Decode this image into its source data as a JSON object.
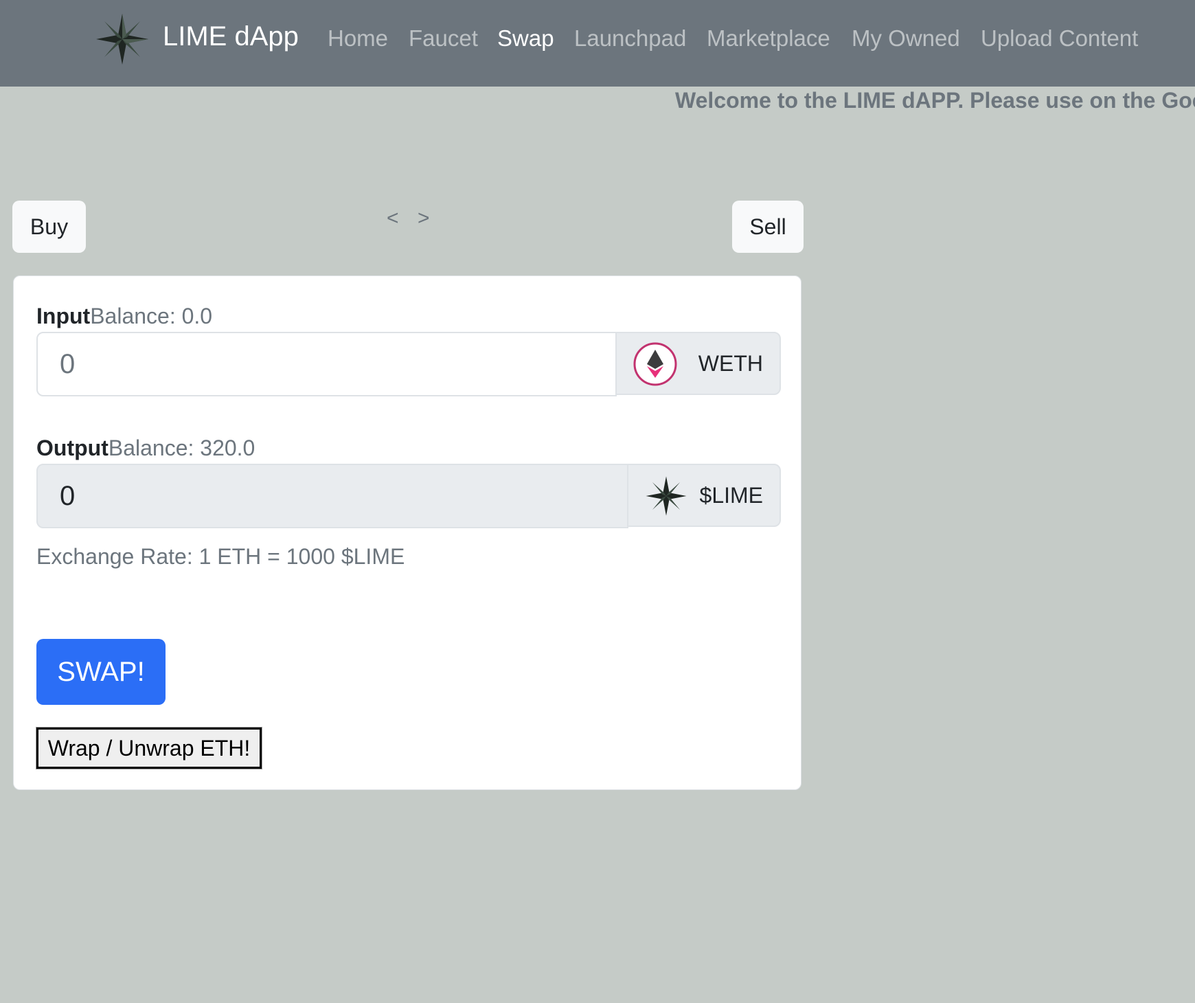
{
  "navbar": {
    "brand": "LIME dApp",
    "logo_icon": "compass-star-icon",
    "links": [
      "Home",
      "Faucet",
      "Swap",
      "Launchpad",
      "Marketplace",
      "My Owned",
      "Upload Content"
    ],
    "active": "Swap"
  },
  "banner": {
    "text": "Welcome to the LIME dAPP. Please use on the Goer"
  },
  "controls": {
    "buy": "Buy",
    "sell": "Sell",
    "prev": "<",
    "next": ">"
  },
  "swap": {
    "input": {
      "label": "Input",
      "balance": "Balance: 0.0",
      "placeholder": "0",
      "token": "WETH",
      "token_icon": "ethereum-icon"
    },
    "output": {
      "label": "Output",
      "balance": "Balance: 320.0",
      "value": "0",
      "token": "$LIME",
      "token_icon": "compass-star-icon"
    },
    "exchange_rate": "Exchange Rate: 1 ETH = 1000 $LIME",
    "swap_button": "SWAP!",
    "wrap_button": "Wrap / Unwrap ETH!"
  },
  "colors": {
    "navbar": "#6c757d",
    "background": "#c5cbc7",
    "primary": "#2b6ef6"
  }
}
